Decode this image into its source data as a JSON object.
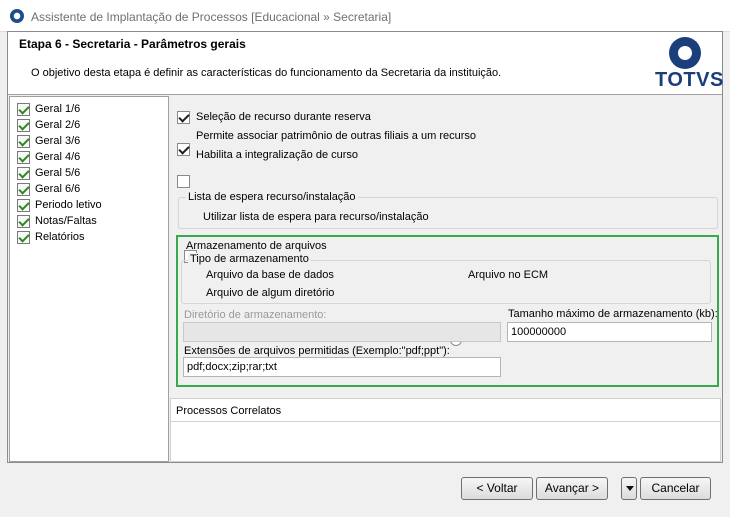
{
  "window": {
    "title": "Assistente de Implantação de Processos [Educacional » Secretaria]"
  },
  "header": {
    "step_title": "Etapa 6 - Secretaria - Parâmetros gerais",
    "description": "O objetivo desta etapa é definir as características do funcionamento da Secretaria da instituição.",
    "logo_text": "TOTVS"
  },
  "nav": {
    "items": [
      {
        "label": "Geral 1/6"
      },
      {
        "label": "Geral 2/6"
      },
      {
        "label": "Geral 3/6"
      },
      {
        "label": "Geral 4/6"
      },
      {
        "label": "Geral 5/6"
      },
      {
        "label": "Geral 6/6"
      },
      {
        "label": "Periodo letivo"
      },
      {
        "label": "Notas/Faltas"
      },
      {
        "label": "Relatórios"
      }
    ]
  },
  "options": {
    "selecao_recurso": {
      "label": "Seleção de recurso durante reserva",
      "checked": true
    },
    "permite_patrimonio": {
      "label": "Permite associar patrimônio de outras filiais a um recurso",
      "checked": true
    },
    "integralizacao": {
      "label": "Habilita a integralização de curso",
      "checked": false
    }
  },
  "waitlist": {
    "group_title": "Lista de espera recurso/instalação",
    "checkbox_label": "Utilizar lista de espera para recurso/instalação",
    "checked": false
  },
  "storage": {
    "group_title": "Armazenamento de arquivos",
    "type_title": "Tipo de armazenamento",
    "radio_db": "Arquivo da base de dados",
    "radio_ecm": "Arquivo no ECM",
    "radio_dir": "Arquivo de algum diretório",
    "selected": "radio_db",
    "directory_label": "Diretório de armazenamento:",
    "directory_value": "",
    "max_size_label": "Tamanho máximo de armazenamento (kb):",
    "max_size_value": "100000000",
    "extensions_label": "Extensões de arquivos permitidas (Exemplo:\"pdf;ppt\"):",
    "extensions_value": "pdf;docx;zip;rar;txt"
  },
  "related": {
    "title": "Processos Correlatos"
  },
  "footer": {
    "back": "< Voltar",
    "next": "Avançar >",
    "cancel": "Cancelar"
  },
  "colors": {
    "highlight_border": "#3aa84c",
    "logo_blue": "#1b3f7a"
  }
}
